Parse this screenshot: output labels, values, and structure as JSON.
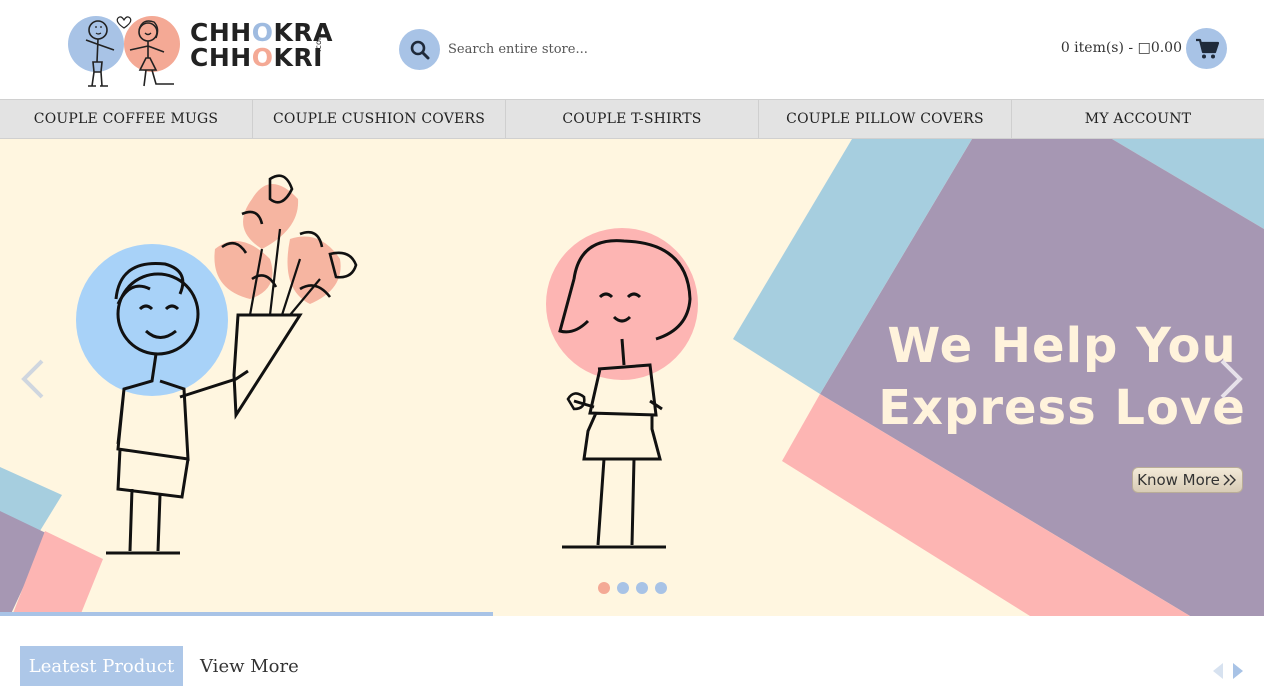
{
  "header": {
    "logo": {
      "line1": "CHHOKRA",
      "line2": "CHHOKRI",
      "suffix": ".com",
      "icon": "couple-logo-icon"
    },
    "search": {
      "placeholder": "Search entire store...",
      "icon": "search-icon"
    },
    "cart": {
      "summary": "0 item(s) - □0.00",
      "icon": "cart-icon"
    }
  },
  "nav": {
    "items": [
      {
        "label": "COUPLE COFFEE MUGS"
      },
      {
        "label": "COUPLE CUSHION COVERS"
      },
      {
        "label": "COUPLE T-SHIRTS"
      },
      {
        "label": "COUPLE PILLOW COVERS"
      },
      {
        "label": "MY ACCOUNT"
      }
    ]
  },
  "banner": {
    "headline_line1": "We Help You",
    "headline_line2": "Express Love",
    "cta_label": "Know More",
    "cta_icon": "double-chevron-right-icon",
    "prev_icon": "chevron-left-icon",
    "next_icon": "chevron-right-icon",
    "slides_total": 4,
    "active_slide": 1,
    "progress_fraction": 0.39
  },
  "products": {
    "tab_label": "Leatest Product",
    "view_more_label": "View More",
    "prev_icon": "triangle-left-icon",
    "next_icon": "triangle-right-icon"
  },
  "colors": {
    "accent_blue": "#a8c3e6",
    "accent_pink": "#f4a995",
    "banner_cream": "#fff6e0",
    "banner_purple": "#a697b3",
    "banner_pink": "#fdb5b3",
    "banner_blue": "#a6cedf",
    "nav_bg": "#e3e3e3"
  }
}
